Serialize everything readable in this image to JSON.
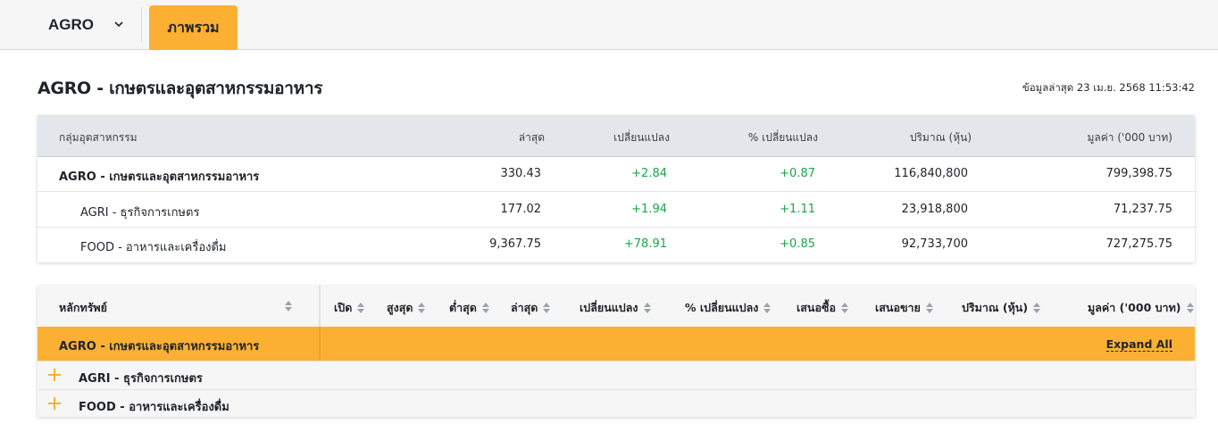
{
  "topbar": {
    "sector_select": "AGRO",
    "active_tab": "ภาพรวม"
  },
  "page": {
    "title": "AGRO - เกษตรและอุตสาหกรรมอาหาร",
    "updated": "ข้อมูลล่าสุด 23 เม.ย. 2568 11:53:42"
  },
  "summary_table": {
    "headers": [
      "กลุ่มอุตสาหกรรม",
      "ล่าสุด",
      "เปลี่ยนแปลง",
      "% เปลี่ยนแปลง",
      "ปริมาณ (หุ้น)",
      "มูลค่า ('000 บาท)"
    ],
    "rows": [
      {
        "name": "AGRO - เกษตรและอุตสาหกรรมอาหาร",
        "last": "330.43",
        "change": "+2.84",
        "pct": "+0.87",
        "volume": "116,840,800",
        "value": "799,398.75"
      },
      {
        "name": "AGRI - ธุรกิจการเกษตร",
        "last": "177.02",
        "change": "+1.94",
        "pct": "+1.11",
        "volume": "23,918,800",
        "value": "71,237.75"
      },
      {
        "name": "FOOD - อาหารและเครื่องดื่ม",
        "last": "9,367.75",
        "change": "+78.91",
        "pct": "+0.85",
        "volume": "92,733,700",
        "value": "727,275.75"
      }
    ]
  },
  "securities_table": {
    "headers": [
      "หลักทรัพย์",
      "เปิด",
      "สูงสุด",
      "ต่ำสุด",
      "ล่าสุด",
      "เปลี่ยนแปลง",
      "% เปลี่ยนแปลง",
      "เสนอซื้อ",
      "เสนอขาย",
      "ปริมาณ (หุ้น)",
      "มูลค่า ('000 บาท)"
    ],
    "group_name": "AGRO - เกษตรและอุตสาหกรรมอาหาร",
    "expand_all": "Expand All",
    "subgroups": [
      "AGRI - ธุรกิจการเกษตร",
      "FOOD - อาหารและเครื่องดื่ม"
    ]
  },
  "colors": {
    "accent": "#fbb034",
    "positive": "#1aa64a",
    "header_bg": "#e3e6ea"
  }
}
